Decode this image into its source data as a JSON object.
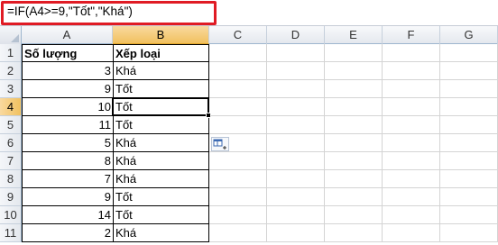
{
  "formula": "=IF(A4>=9,\"Tốt\",\"Khá\")",
  "columns": [
    "A",
    "B",
    "C",
    "D",
    "E",
    "F",
    "G"
  ],
  "active_column": "B",
  "active_row": 4,
  "rows": [
    {
      "num": "1",
      "a": "Số lượng",
      "b": "Xếp loại",
      "header": true
    },
    {
      "num": "2",
      "a": "3",
      "b": "Khá"
    },
    {
      "num": "3",
      "a": "9",
      "b": "Tốt"
    },
    {
      "num": "4",
      "a": "10",
      "b": "Tốt"
    },
    {
      "num": "5",
      "a": "11",
      "b": "Tốt"
    },
    {
      "num": "6",
      "a": "5",
      "b": "Khá"
    },
    {
      "num": "7",
      "a": "8",
      "b": "Khá"
    },
    {
      "num": "8",
      "a": "7",
      "b": "Khá"
    },
    {
      "num": "9",
      "a": "9",
      "b": "Tốt"
    },
    {
      "num": "10",
      "a": "14",
      "b": "Tốt"
    },
    {
      "num": "11",
      "a": "2",
      "b": "Khá"
    }
  ],
  "icons": {
    "paste_options": "paste-options-icon"
  },
  "colors": {
    "formula_highlight": "#e01b24",
    "active_header": "#f1c15f"
  }
}
